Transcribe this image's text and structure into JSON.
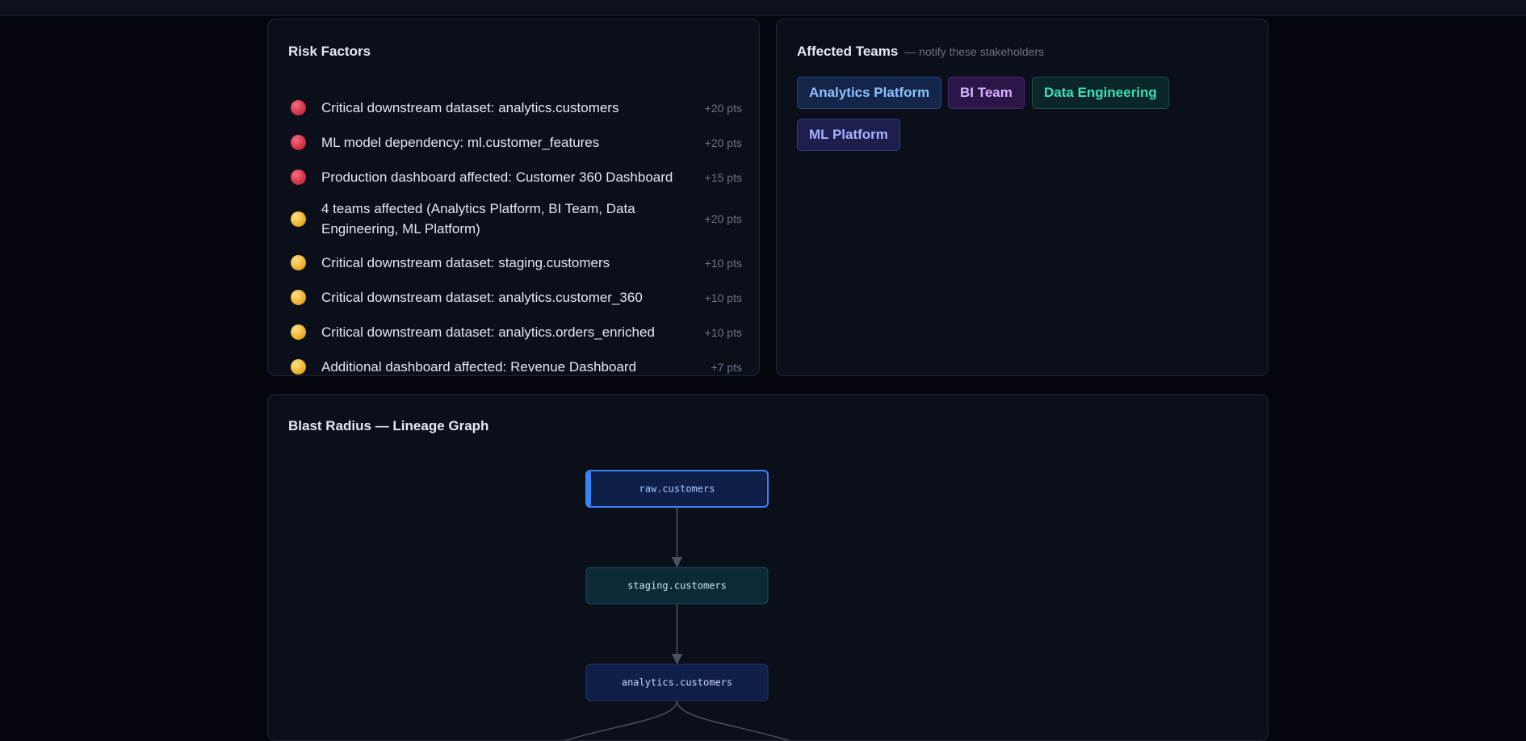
{
  "risk_factors": {
    "title": "Risk Factors",
    "items": [
      {
        "severity": "red",
        "text": "Critical downstream dataset: analytics.customers",
        "points": "+20 pts"
      },
      {
        "severity": "red",
        "text": "ML model dependency: ml.customer_features",
        "points": "+20 pts"
      },
      {
        "severity": "red",
        "text": "Production dashboard affected: Customer 360 Dashboard",
        "points": "+15 pts"
      },
      {
        "severity": "yellow",
        "text": "4 teams affected (Analytics Platform, BI Team, Data Engineering, ML Platform)",
        "points": "+20 pts"
      },
      {
        "severity": "yellow",
        "text": "Critical downstream dataset: staging.customers",
        "points": "+10 pts"
      },
      {
        "severity": "yellow",
        "text": "Critical downstream dataset: analytics.customer_360",
        "points": "+10 pts"
      },
      {
        "severity": "yellow",
        "text": "Critical downstream dataset: analytics.orders_enriched",
        "points": "+10 pts"
      },
      {
        "severity": "yellow",
        "text": "Additional dashboard affected: Revenue Dashboard",
        "points": "+7 pts"
      }
    ]
  },
  "affected_teams": {
    "title": "Affected Teams",
    "subtitle": "— notify these stakeholders",
    "teams": [
      {
        "name": "Analytics Platform",
        "color": "blue"
      },
      {
        "name": "BI Team",
        "color": "purple"
      },
      {
        "name": "Data Engineering",
        "color": "green"
      },
      {
        "name": "ML Platform",
        "color": "indigo"
      }
    ]
  },
  "blast_radius": {
    "title": "Blast Radius — Lineage Graph",
    "nodes": [
      {
        "id": "raw.customers",
        "label": "raw.customers",
        "kind": "source"
      },
      {
        "id": "staging.customers",
        "label": "staging.customers",
        "kind": "staging"
      },
      {
        "id": "analytics.customers",
        "label": "analytics.customers",
        "kind": "analytics"
      }
    ],
    "edges": [
      {
        "from": "raw.customers",
        "to": "staging.customers"
      },
      {
        "from": "staging.customers",
        "to": "analytics.customers"
      }
    ]
  },
  "colors": {
    "background": "#03060d",
    "card": "#0a0f1a",
    "card_border": "#1f2737",
    "risk_high": "#d8364a",
    "risk_medium": "#f0b62f",
    "source_node_border": "#3b82f6",
    "staging_node_fill": "#0b2a36",
    "analytics_node_fill": "#0f1f4a",
    "edge": "#4a5160"
  }
}
